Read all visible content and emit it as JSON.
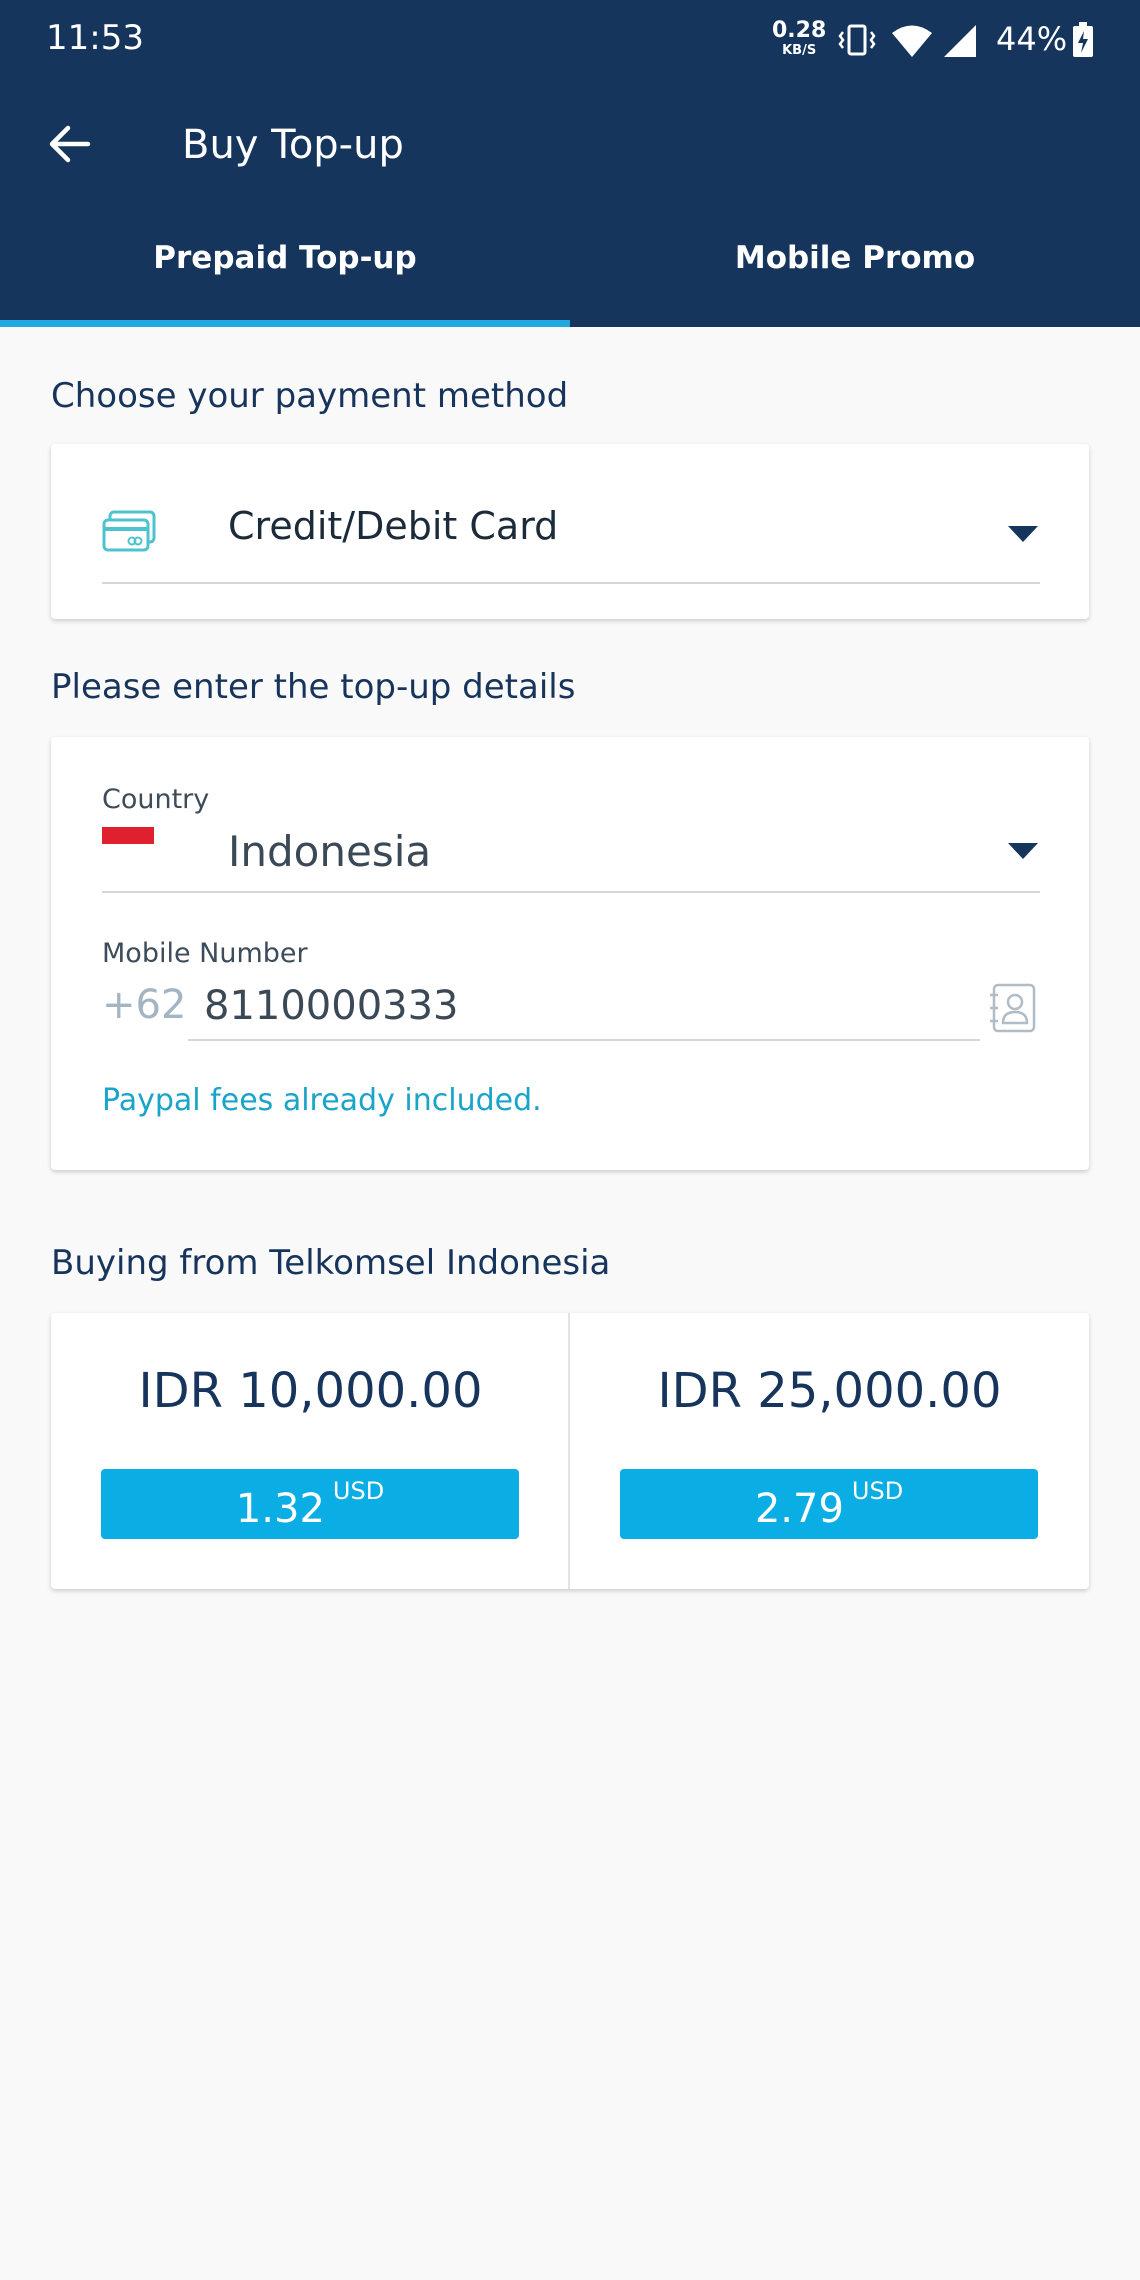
{
  "status_bar": {
    "time": "11:53",
    "net_speed_value": "0.28",
    "net_speed_unit": "KB/S",
    "battery_pct": "44%"
  },
  "header": {
    "title": "Buy Top-up",
    "back_icon": "arrow-left-icon"
  },
  "tabs": [
    {
      "label": "Prepaid Top-up",
      "active": true
    },
    {
      "label": "Mobile Promo",
      "active": false
    }
  ],
  "payment": {
    "section_label": "Choose your payment method",
    "method": "Credit/Debit Card",
    "icon": "credit-card-icon"
  },
  "details": {
    "section_label": "Please enter the top-up details",
    "country_label": "Country",
    "country_value": "Indonesia",
    "mobile_label": "Mobile Number",
    "prefix": "+62",
    "mobile_value": "8110000333",
    "fee_note": "Paypal fees already included."
  },
  "offers": {
    "section_label": "Buying from Telkomsel Indonesia",
    "items": [
      {
        "amount": "IDR 10,000.00",
        "price": "1.32",
        "currency": "USD"
      },
      {
        "amount": "IDR 25,000.00",
        "price": "2.79",
        "currency": "USD"
      }
    ]
  },
  "colors": {
    "header_bg": "#15355d",
    "tab_indicator": "#22a8e0",
    "price_button": "#0aaee4",
    "fee_note": "#1aa4c9"
  }
}
